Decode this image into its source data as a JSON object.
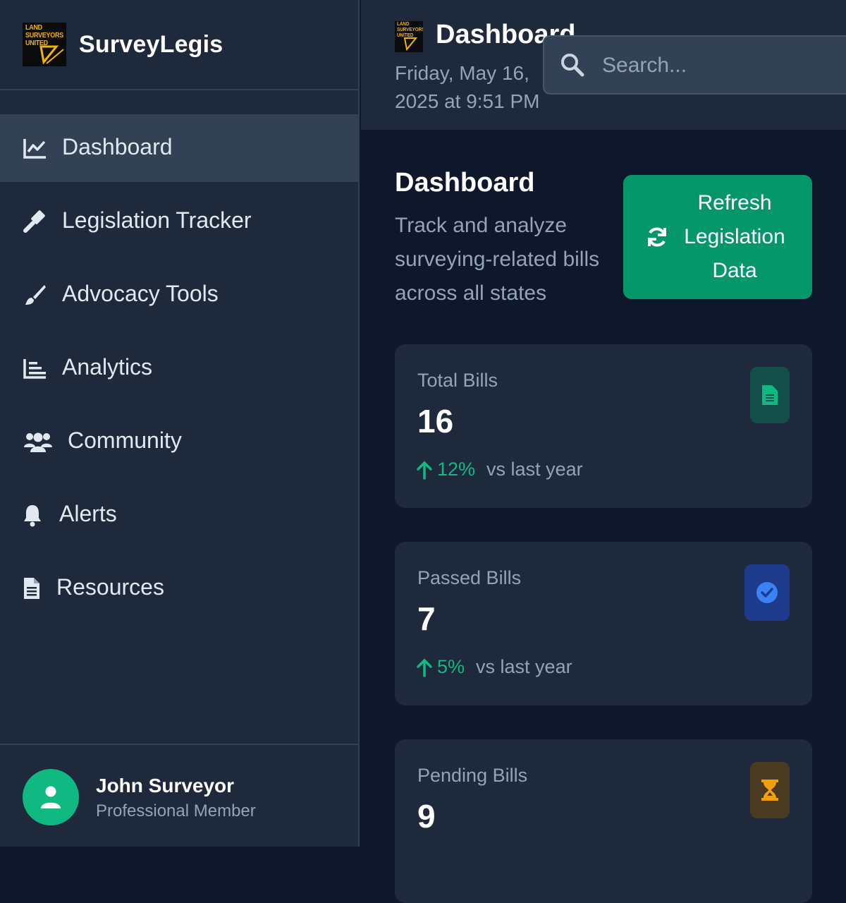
{
  "sidebar": {
    "logo_text": [
      "LAND",
      "SURVEYORS",
      "UNITED"
    ],
    "brand": "SurveyLegis",
    "items": [
      {
        "label": "Dashboard",
        "icon": "chart-line-icon",
        "active": true
      },
      {
        "label": "Legislation Tracker",
        "icon": "gavel-icon",
        "active": false
      },
      {
        "label": "Advocacy Tools",
        "icon": "paintbrush-icon",
        "active": false
      },
      {
        "label": "Analytics",
        "icon": "bar-chart-icon",
        "active": false
      },
      {
        "label": "Community",
        "icon": "users-icon",
        "active": false
      },
      {
        "label": "Alerts",
        "icon": "bell-icon",
        "active": false
      },
      {
        "label": "Resources",
        "icon": "file-icon",
        "active": false
      }
    ],
    "user": {
      "name": "John Surveyor",
      "role": "Professional Member",
      "icon": "user-icon"
    }
  },
  "header": {
    "title": "Dashboard",
    "date": "Friday, May 16, 2025 at 9:51 PM",
    "search_placeholder": "Search..."
  },
  "main": {
    "title": "Dashboard",
    "subtitle": "Track and analyze surveying-related bills across all states",
    "refresh_label": "Refresh Legislation Data",
    "cards": [
      {
        "label": "Total Bills",
        "value": "16",
        "trend": "12%",
        "trend_text": "vs last year",
        "icon": "document-icon",
        "color": "#10b981"
      },
      {
        "label": "Passed Bills",
        "value": "7",
        "trend": "5%",
        "trend_text": "vs last year",
        "icon": "check-circle-icon",
        "color": "#3b82f6"
      },
      {
        "label": "Pending Bills",
        "value": "9",
        "icon": "hourglass-icon",
        "color": "#f59e0b"
      }
    ]
  },
  "colors": {
    "accent": "#10b981",
    "button": "#059669",
    "sidebar": "#1e293b",
    "background": "#0f172a"
  }
}
